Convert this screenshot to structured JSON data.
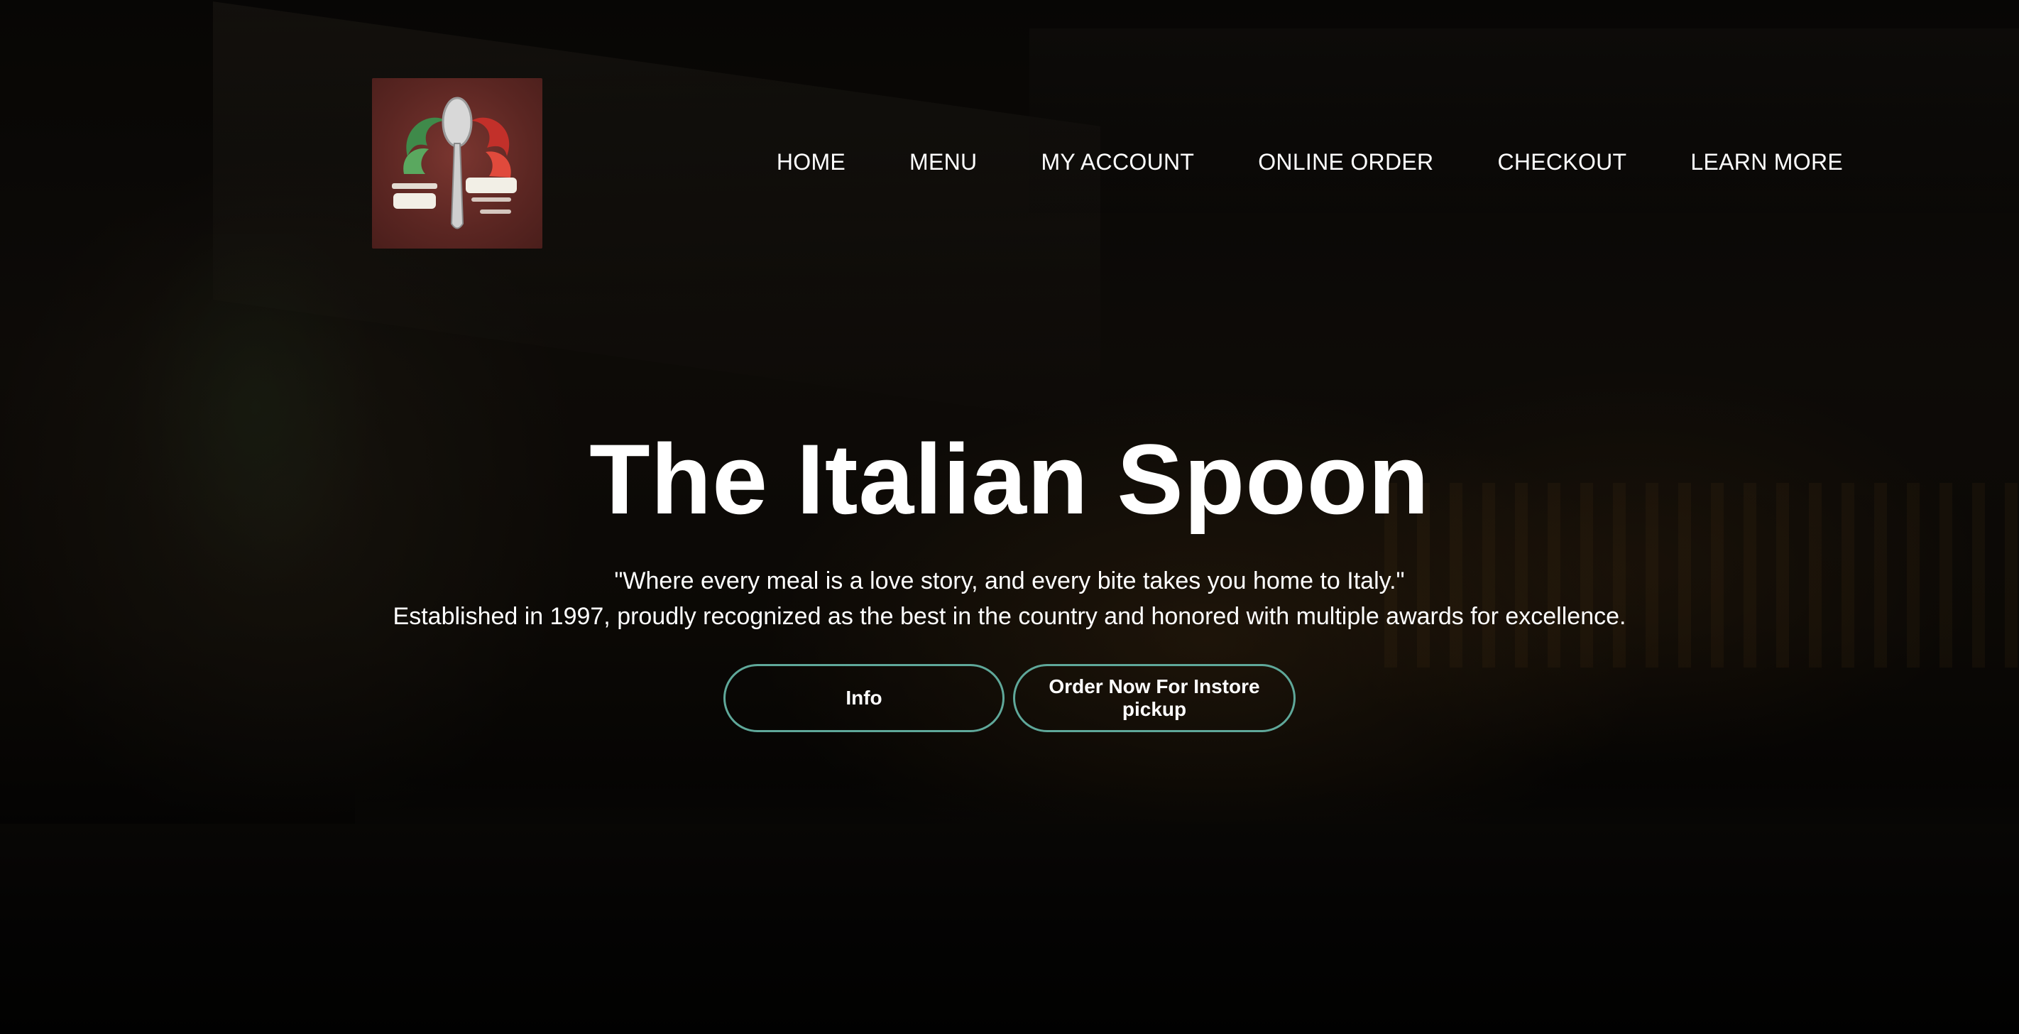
{
  "brand": {
    "logo_icon": "spoon-logo-icon",
    "logo_colors": {
      "green": "#3f8a4a",
      "red": "#c2302a",
      "bg": "#5b2622"
    }
  },
  "nav": {
    "items": [
      {
        "label": "HOME"
      },
      {
        "label": "MENU"
      },
      {
        "label": "MY ACCOUNT"
      },
      {
        "label": "ONLINE ORDER"
      },
      {
        "label": "CHECKOUT"
      },
      {
        "label": "LEARN MORE"
      }
    ]
  },
  "hero": {
    "title": "The Italian Spoon",
    "quote": "\"Where every meal is a love story, and every bite takes you home to Italy.\"",
    "subtitle": "Established in 1997, proudly recognized as the best in the country and honored with multiple awards for excellence.",
    "buttons": {
      "info": "Info",
      "order": "Order Now For Instore pickup"
    },
    "button_border_color": "#5fa89a"
  }
}
